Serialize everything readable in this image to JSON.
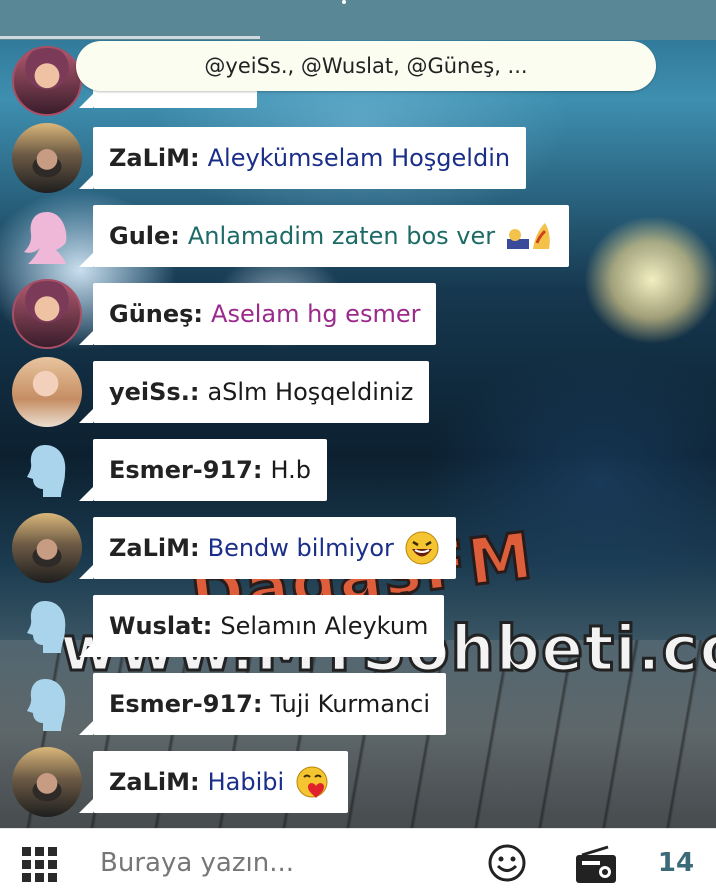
{
  "mentions": "@yeiSs., @Wuslat, @Güneş, ...",
  "messages": [
    {
      "nick": "ZaLiM:",
      "text": "Aleykümselam Hoşgeldin",
      "color": "#1b2f8a"
    },
    {
      "nick": "Gule:",
      "text": "Anlamadim zaten bos ver",
      "color": "#1d6b66"
    },
    {
      "nick": "Güneş:",
      "text": "Aselam hg esmer",
      "color": "#9a2a8c"
    },
    {
      "nick": "yeiSs.:",
      "text": "aSlm Hoşqeldiniz",
      "color": "#1a1a1a"
    },
    {
      "nick": "Esmer-917:",
      "text": "H.b",
      "color": "#1a1a1a"
    },
    {
      "nick": "ZaLiM:",
      "text": "Bendw bilmiyor",
      "color": "#1b2f8a"
    },
    {
      "nick": "Wuslat:",
      "text": "Selamın Aleykum",
      "color": "#1a1a1a"
    },
    {
      "nick": "Esmer-917:",
      "text": "Tuji Kurmanci",
      "color": "#1a1a1a"
    },
    {
      "nick": "ZaLiM:",
      "text": "Habibi",
      "color": "#1b2f8a"
    }
  ],
  "input": {
    "placeholder": "Buraya yazın..."
  },
  "bottom": {
    "count": "14"
  },
  "icons": {
    "menu": "grid-icon",
    "emoji": "smiley-icon",
    "radio": "radio-icon"
  },
  "watermark": {
    "line1": "DadaşFM",
    "line2": "www.MTSohbeti.com"
  }
}
